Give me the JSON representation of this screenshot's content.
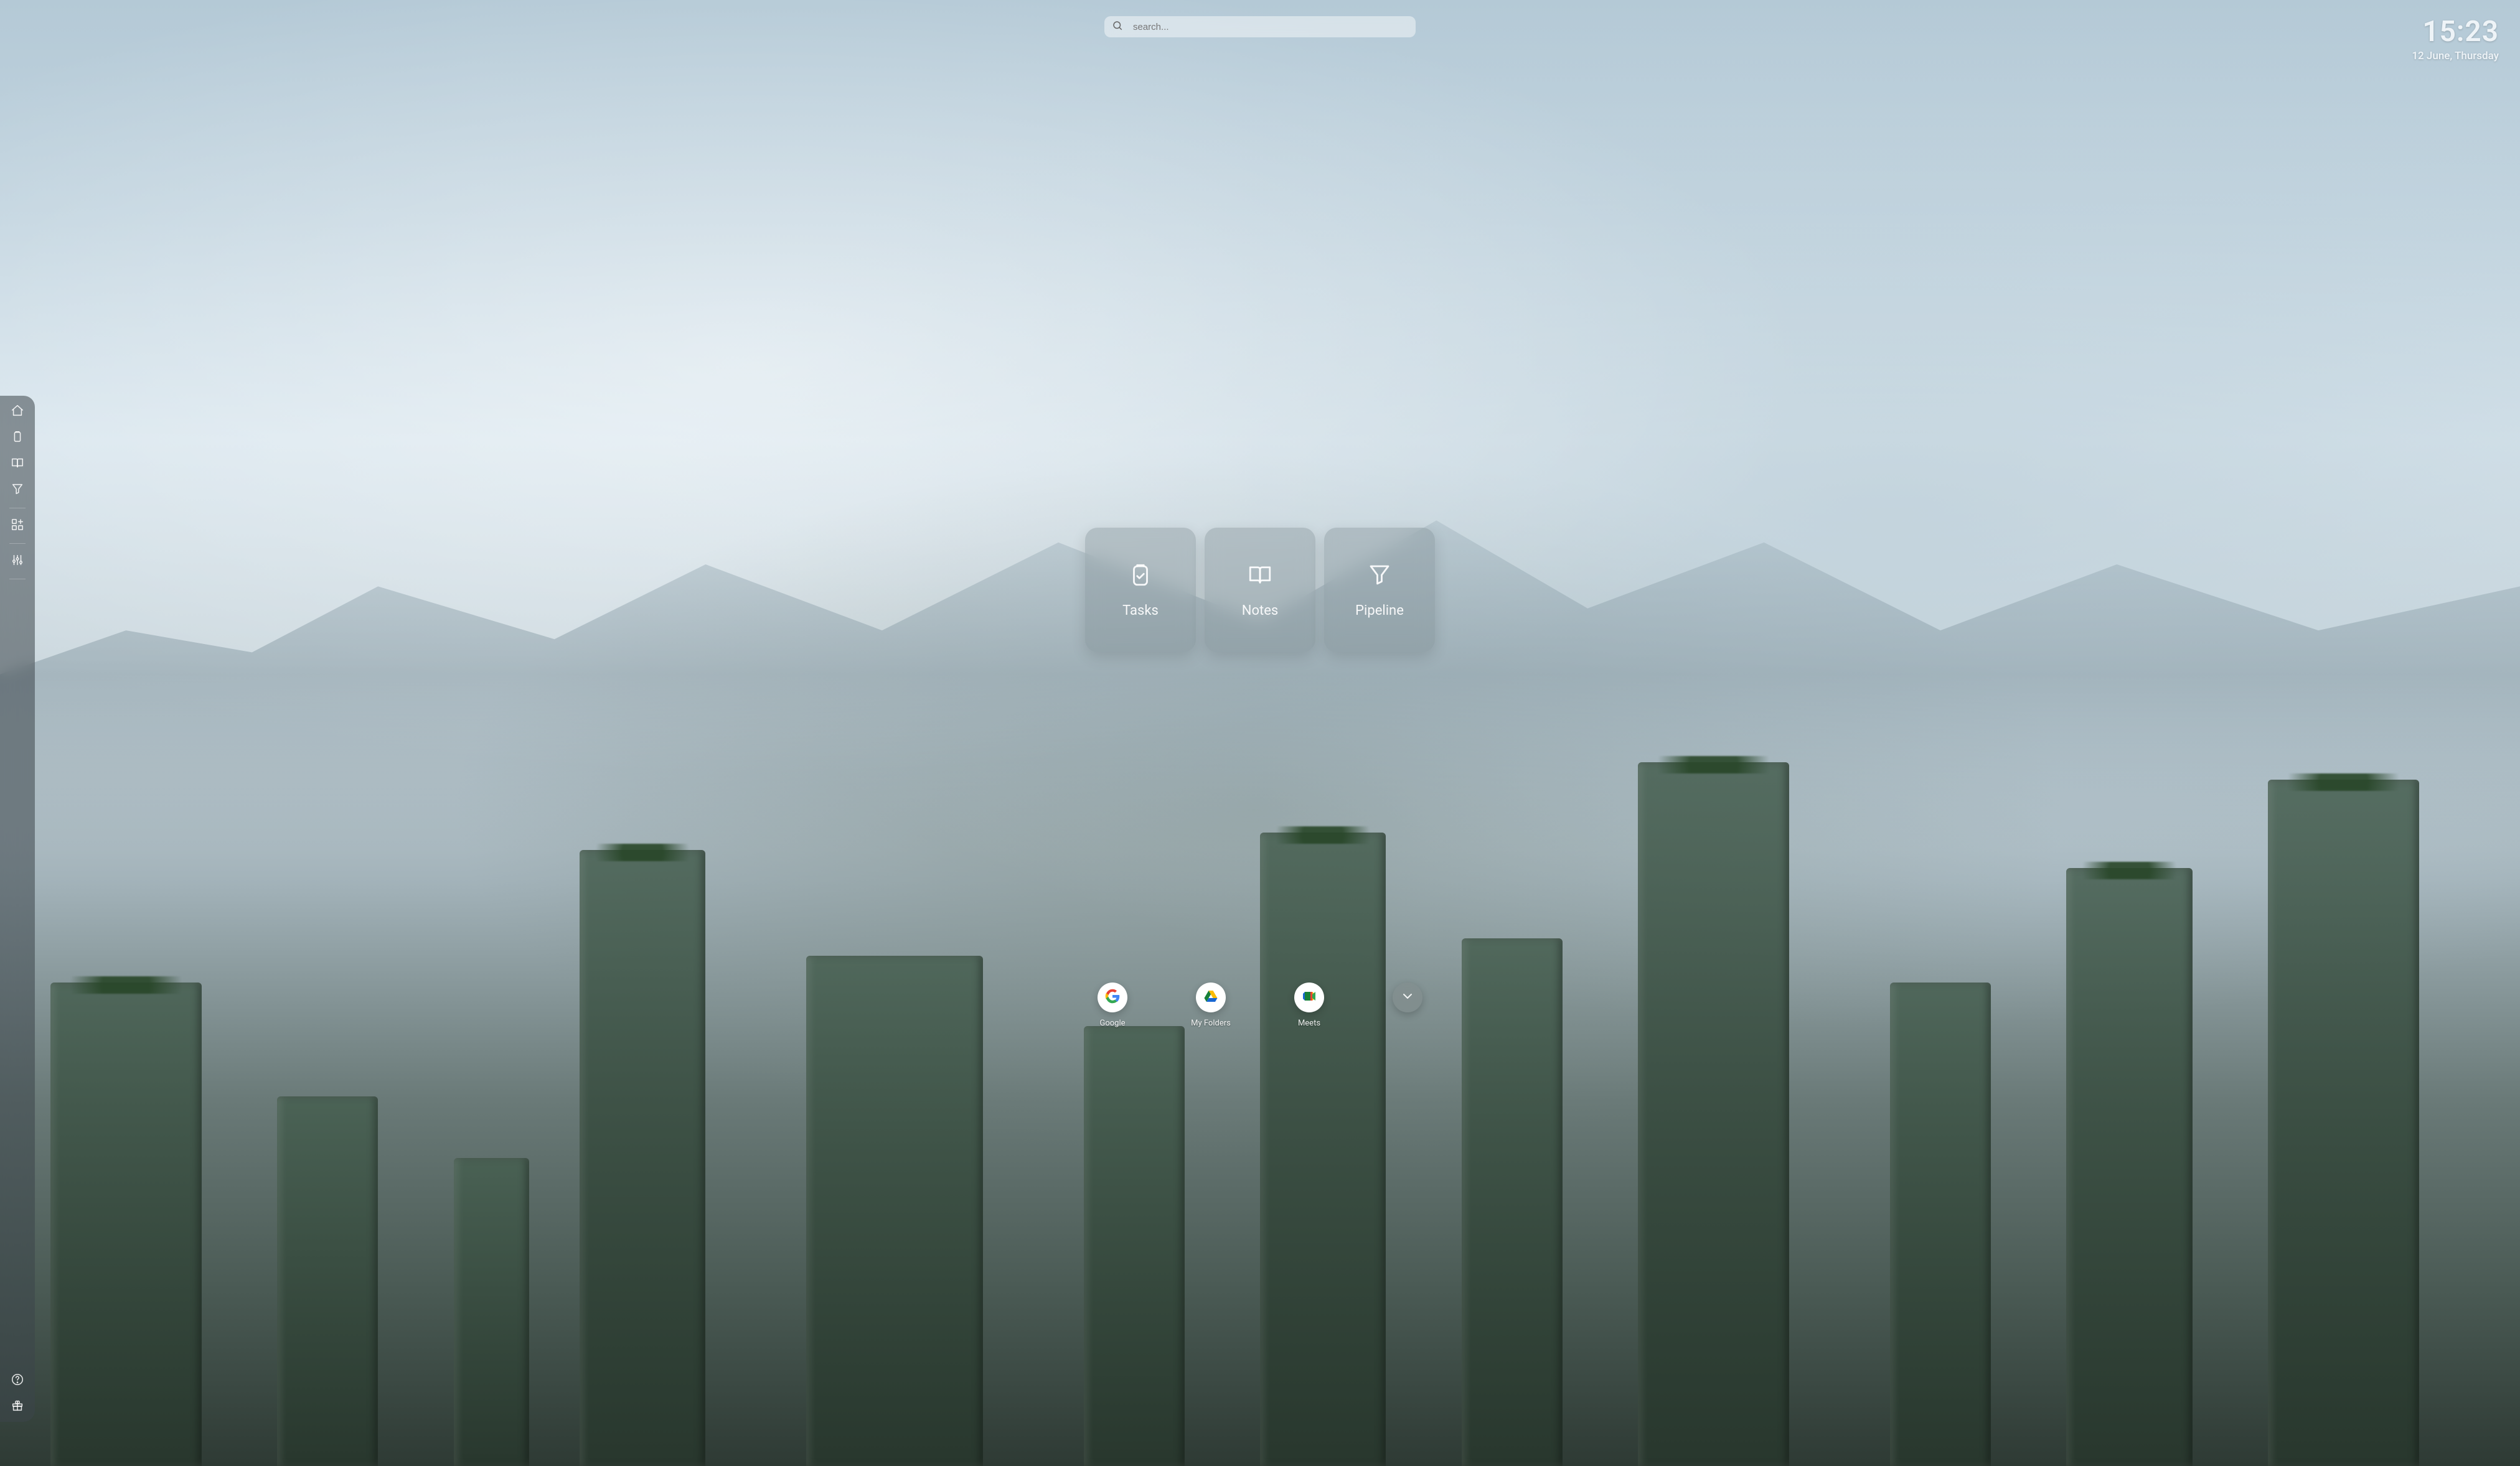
{
  "search": {
    "placeholder": "search..."
  },
  "clock": {
    "time": "15:23",
    "date": "12 June, Thursday"
  },
  "cards": [
    {
      "label": "Tasks",
      "icon": "clipboard-check-icon"
    },
    {
      "label": "Notes",
      "icon": "book-open-icon"
    },
    {
      "label": "Pipeline",
      "icon": "funnel-icon"
    }
  ],
  "shortcuts": [
    {
      "label": "Google",
      "icon": "google-logo-icon"
    },
    {
      "label": "My Folders",
      "icon": "google-drive-icon"
    },
    {
      "label": "Meets",
      "icon": "google-meet-icon"
    }
  ],
  "sidebar": {
    "primary": [
      {
        "name": "home-icon"
      },
      {
        "name": "clipboard-icon"
      },
      {
        "name": "book-open-icon"
      },
      {
        "name": "funnel-icon"
      }
    ],
    "middle": [
      {
        "name": "widgets-icon"
      }
    ],
    "settings": [
      {
        "name": "sliders-icon"
      }
    ],
    "footer": [
      {
        "name": "help-icon"
      },
      {
        "name": "gift-icon"
      }
    ]
  }
}
